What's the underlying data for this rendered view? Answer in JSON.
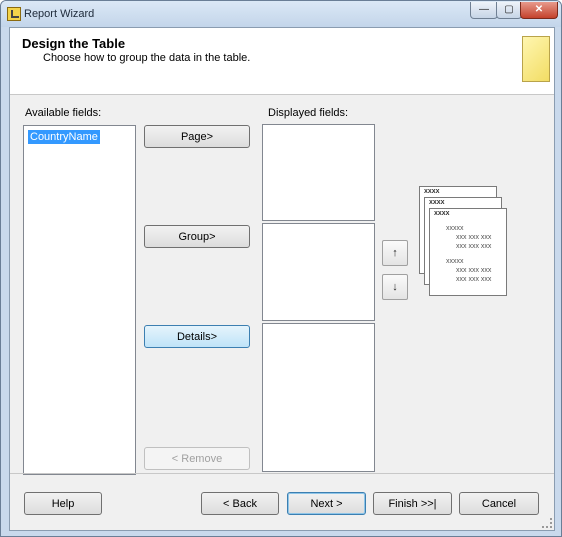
{
  "window": {
    "title": "Report Wizard",
    "minimize": "—",
    "maximize": "▢",
    "close": "✕"
  },
  "header": {
    "title": "Design the Table",
    "subtitle": "Choose how to group the data in the table."
  },
  "available": {
    "label": "Available fields:",
    "items": [
      "CountryName"
    ]
  },
  "displayed": {
    "label": "Displayed fields:"
  },
  "buttons": {
    "page": "Page>",
    "group": "Group>",
    "details": "Details>",
    "remove": "< Remove",
    "up": "↑",
    "down": "↓"
  },
  "preview": {
    "page_label": "xxxx",
    "group_label": "xxxxx",
    "row_text": "xxx xxx xxx"
  },
  "footer": {
    "help": "Help",
    "back": "< Back",
    "next": "Next >",
    "finish": "Finish >>|",
    "cancel": "Cancel"
  }
}
